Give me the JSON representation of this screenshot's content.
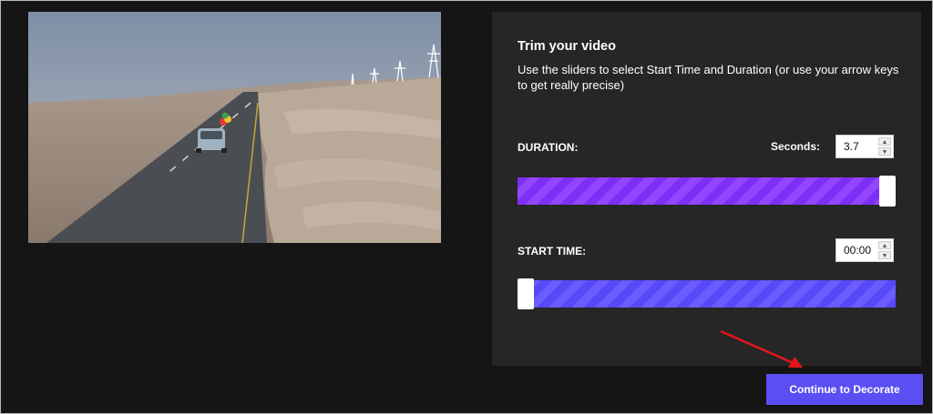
{
  "video_preview": {
    "description_icon": "desert-road-car-balloons-thumbnail"
  },
  "trim_panel": {
    "title": "Trim your video",
    "description": "Use the sliders to select Start Time and Duration (or use your arrow keys to get really precise)",
    "duration": {
      "label": "DURATION:",
      "seconds_label": "Seconds:",
      "value": "3.7",
      "slider_position": 1.0,
      "color": "#8c3ffd"
    },
    "start_time": {
      "label": "START TIME:",
      "value": "00:00",
      "slider_position": 0.0,
      "color": "#5e50fa"
    }
  },
  "continue_button": {
    "label": "Continue to Decorate",
    "color": "#5b4ef2"
  },
  "annotation_arrow_color": "#e8141c"
}
